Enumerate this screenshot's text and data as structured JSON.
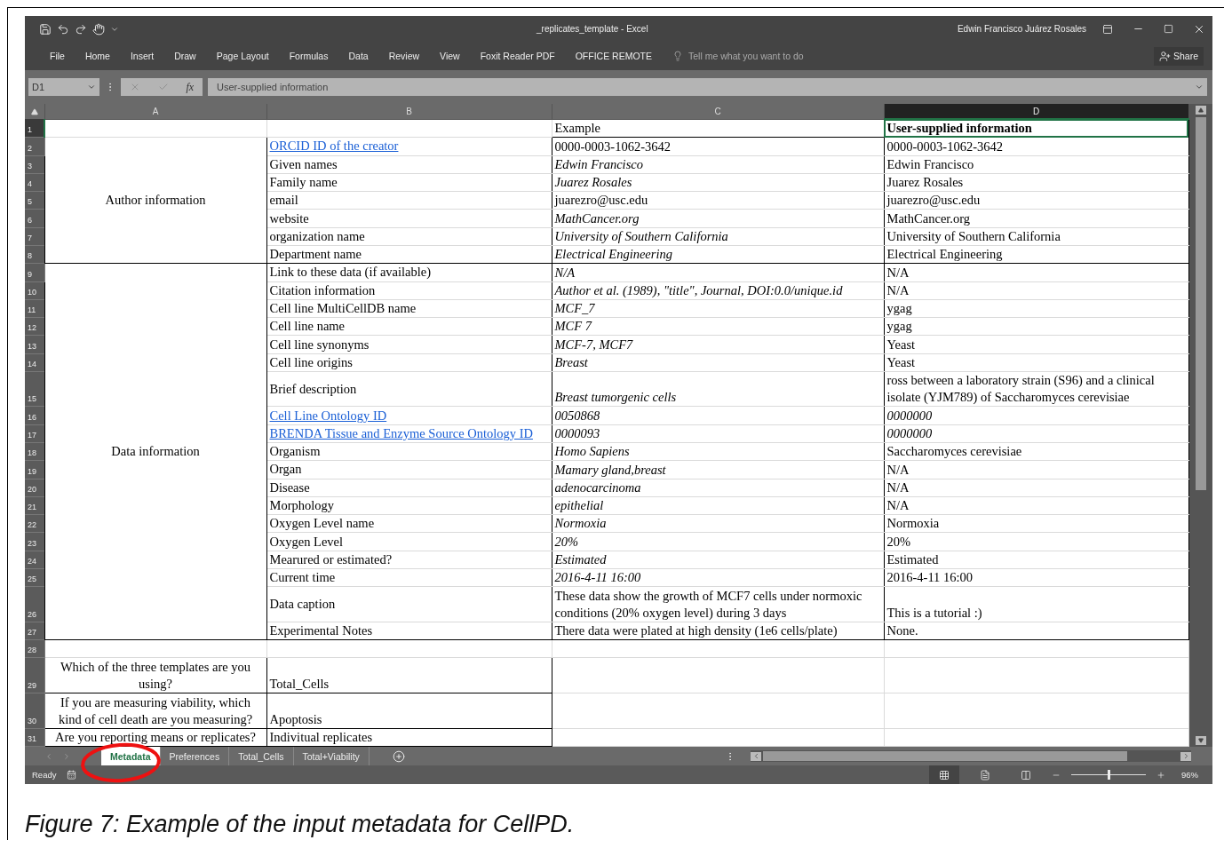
{
  "window": {
    "title": "_replicates_template - Excel",
    "user": "Edwin Francisco Juárez Rosales"
  },
  "ribbon": {
    "tabs": [
      "File",
      "Home",
      "Insert",
      "Draw",
      "Page Layout",
      "Formulas",
      "Data",
      "Review",
      "View",
      "Foxit Reader PDF",
      "OFFICE REMOTE"
    ],
    "tell_me": {
      "placeholder": "Tell me what you want to do"
    },
    "share": "Share"
  },
  "formula_bar": {
    "name_box": "D1",
    "function_label": "fx",
    "value": "User-supplied information"
  },
  "sheet": {
    "columns": [
      {
        "label": "A",
        "selected": false
      },
      {
        "label": "B",
        "selected": false
      },
      {
        "label": "C",
        "selected": false
      },
      {
        "label": "D",
        "selected": true
      }
    ],
    "blocks": [
      {
        "kind": "header",
        "rows": [
          {
            "number": "1",
            "selected": true,
            "c": {
              "text": "Example",
              "kind": "plain"
            },
            "d": {
              "text": "User-supplied information",
              "kind": "bold"
            }
          }
        ]
      },
      {
        "kind": "group",
        "label": "Author information",
        "rows": [
          {
            "number": "2",
            "selected": false,
            "b": {
              "text": "ORCID ID of the creator",
              "kind": "link"
            },
            "c": {
              "text": "0000-0003-1062-3642",
              "kind": "plain"
            },
            "d": {
              "text": "0000-0003-1062-3642",
              "kind": "plain"
            }
          },
          {
            "number": "3",
            "selected": false,
            "b": {
              "text": "Given names",
              "kind": "plain"
            },
            "c": {
              "text": "Edwin Francisco",
              "kind": "italic"
            },
            "d": {
              "text": "Edwin Francisco",
              "kind": "plain"
            }
          },
          {
            "number": "4",
            "selected": false,
            "b": {
              "text": "Family name",
              "kind": "plain"
            },
            "c": {
              "text": "Juarez Rosales",
              "kind": "italic"
            },
            "d": {
              "text": "Juarez Rosales",
              "kind": "plain"
            }
          },
          {
            "number": "5",
            "selected": false,
            "b": {
              "text": "email",
              "kind": "plain"
            },
            "c": {
              "text": "juarezro@usc.edu",
              "kind": "plain"
            },
            "d": {
              "text": "juarezro@usc.edu",
              "kind": "plain"
            }
          },
          {
            "number": "6",
            "selected": false,
            "b": {
              "text": "website",
              "kind": "plain"
            },
            "c": {
              "text": "MathCancer.org",
              "kind": "italic"
            },
            "d": {
              "text": "MathCancer.org",
              "kind": "plain"
            }
          },
          {
            "number": "7",
            "selected": false,
            "b": {
              "text": "organization name",
              "kind": "plain"
            },
            "c": {
              "text": "University of Southern California",
              "kind": "italic"
            },
            "d": {
              "text": "University of Southern California",
              "kind": "plain"
            }
          },
          {
            "number": "8",
            "selected": false,
            "b": {
              "text": "Department name",
              "kind": "plain"
            },
            "c": {
              "text": "Electrical Engineering",
              "kind": "italic"
            },
            "d": {
              "text": "Electrical Engineering",
              "kind": "plain"
            }
          }
        ]
      },
      {
        "kind": "group",
        "label": "Data information",
        "rows": [
          {
            "number": "9",
            "selected": false,
            "b": {
              "text": "Link to these data (if available)",
              "kind": "plain"
            },
            "c": {
              "text": "N/A",
              "kind": "italic"
            },
            "d": {
              "text": "N/A",
              "kind": "plain"
            }
          },
          {
            "number": "10",
            "selected": false,
            "b": {
              "text": "Citation information",
              "kind": "plain"
            },
            "c": {
              "text": "Author et al. (1989), \"title\", Journal, DOI:0.0/unique.id",
              "kind": "italic"
            },
            "d": {
              "text": "N/A",
              "kind": "plain"
            }
          },
          {
            "number": "11",
            "selected": false,
            "b": {
              "text": "Cell line MultiCellDB name",
              "kind": "plain"
            },
            "c": {
              "text": "MCF_7",
              "kind": "italic"
            },
            "d": {
              "text": "ygag",
              "kind": "plain"
            }
          },
          {
            "number": "12",
            "selected": false,
            "b": {
              "text": "Cell line name",
              "kind": "plain"
            },
            "c": {
              "text": "MCF 7",
              "kind": "italic"
            },
            "d": {
              "text": "ygag",
              "kind": "plain"
            }
          },
          {
            "number": "13",
            "selected": false,
            "b": {
              "text": "Cell line synonyms",
              "kind": "plain"
            },
            "c": {
              "text": "MCF-7, MCF7",
              "kind": "italic"
            },
            "d": {
              "text": "Yeast",
              "kind": "plain"
            }
          },
          {
            "number": "14",
            "selected": false,
            "b": {
              "text": "Cell line origins",
              "kind": "plain"
            },
            "c": {
              "text": "Breast",
              "kind": "italic"
            },
            "d": {
              "text": "Yeast",
              "kind": "plain"
            }
          },
          {
            "number": "15",
            "selected": false,
            "b": {
              "text": "Brief description",
              "kind": "plain"
            },
            "c": {
              "text": "Breast tumorgenic cells",
              "kind": "italic"
            },
            "d": {
              "text": "ross between a laboratory strain (S96) and a clinical isolate (YJM789) of Saccharomyces cerevisiae",
              "kind": "plain"
            }
          },
          {
            "number": "16",
            "selected": false,
            "b": {
              "text": "Cell Line Ontology ID",
              "kind": "link"
            },
            "c": {
              "text": "0050868",
              "kind": "italic"
            },
            "d": {
              "text": "0000000",
              "kind": "italic"
            }
          },
          {
            "number": "17",
            "selected": false,
            "b": {
              "text": "BRENDA Tissue and Enzyme Source Ontology ID",
              "kind": "link"
            },
            "c": {
              "text": "0000093",
              "kind": "italic"
            },
            "d": {
              "text": "0000000",
              "kind": "italic"
            }
          },
          {
            "number": "18",
            "selected": false,
            "b": {
              "text": "Organism",
              "kind": "plain"
            },
            "c": {
              "text": "Homo Sapiens",
              "kind": "italic"
            },
            "d": {
              "text": "Saccharomyces cerevisiae",
              "kind": "plain"
            }
          },
          {
            "number": "19",
            "selected": false,
            "b": {
              "text": "Organ",
              "kind": "plain"
            },
            "c": {
              "text": "Mamary gland,breast",
              "kind": "italic"
            },
            "d": {
              "text": "N/A",
              "kind": "plain"
            }
          },
          {
            "number": "20",
            "selected": false,
            "b": {
              "text": "Disease",
              "kind": "plain"
            },
            "c": {
              "text": "adenocarcinoma",
              "kind": "italic"
            },
            "d": {
              "text": "N/A",
              "kind": "plain"
            }
          },
          {
            "number": "21",
            "selected": false,
            "b": {
              "text": "Morphology",
              "kind": "plain"
            },
            "c": {
              "text": "epithelial",
              "kind": "italic"
            },
            "d": {
              "text": "N/A",
              "kind": "plain"
            }
          },
          {
            "number": "22",
            "selected": false,
            "b": {
              "text": "Oxygen Level name",
              "kind": "plain"
            },
            "c": {
              "text": "Normoxia",
              "kind": "italic"
            },
            "d": {
              "text": "Normoxia",
              "kind": "plain"
            }
          },
          {
            "number": "23",
            "selected": false,
            "b": {
              "text": "Oxygen Level",
              "kind": "plain"
            },
            "c": {
              "text": "20%",
              "kind": "italic"
            },
            "d": {
              "text": "20%",
              "kind": "plain"
            }
          },
          {
            "number": "24",
            "selected": false,
            "b": {
              "text": "Mearured or estimated?",
              "kind": "plain"
            },
            "c": {
              "text": "Estimated",
              "kind": "italic"
            },
            "d": {
              "text": "Estimated",
              "kind": "plain"
            }
          },
          {
            "number": "25",
            "selected": false,
            "b": {
              "text": "Current time",
              "kind": "plain"
            },
            "c": {
              "text": "2016-4-11 16:00",
              "kind": "italic"
            },
            "d": {
              "text": "2016-4-11 16:00",
              "kind": "plain"
            }
          },
          {
            "number": "26",
            "selected": false,
            "b": {
              "text": "Data caption",
              "kind": "plain"
            },
            "c": {
              "text": "These data show the growth of MCF7 cells under normoxic conditions (20% oxygen level) during 3 days",
              "kind": "plain"
            },
            "d": {
              "text": "This is a tutorial :)",
              "kind": "plain"
            }
          },
          {
            "number": "27",
            "selected": false,
            "b": {
              "text": "Experimental Notes",
              "kind": "plain"
            },
            "c": {
              "text": "There data were plated at high density (1e6 cells/plate)",
              "kind": "plain"
            },
            "d": {
              "text": "None.",
              "kind": "plain"
            }
          }
        ]
      },
      {
        "kind": "blank",
        "rows": [
          {
            "number": "28",
            "selected": false
          }
        ]
      },
      {
        "kind": "question",
        "rows": [
          {
            "number": "29",
            "selected": false,
            "a": {
              "text": "Which of the three templates are you using?",
              "kind": "plain"
            },
            "b": {
              "text": "Total_Cells",
              "kind": "plain"
            }
          },
          {
            "number": "30",
            "selected": false,
            "a": {
              "text": "If you are measuring viability, which kind of cell death are you measuring?",
              "kind": "plain"
            },
            "b": {
              "text": "Apoptosis",
              "kind": "plain"
            }
          },
          {
            "number": "31",
            "selected": false,
            "a": {
              "text": "Are you reporting means or replicates?",
              "kind": "plain"
            },
            "b": {
              "text": "Indivitual replicates",
              "kind": "plain"
            }
          }
        ]
      }
    ]
  },
  "sheet_tabs": [
    {
      "label": "Metadata",
      "selected": true
    },
    {
      "label": "Preferences",
      "selected": false
    },
    {
      "label": "Total_Cells",
      "selected": false
    },
    {
      "label": "Total+Viability",
      "selected": false
    }
  ],
  "status_bar": {
    "status": "Ready",
    "views": [
      {
        "kind": "normal",
        "selected": true
      },
      {
        "kind": "page_layout",
        "selected": false
      },
      {
        "kind": "page_break",
        "selected": false
      }
    ],
    "zoom": {
      "level": 0.5,
      "reading": "96%"
    }
  },
  "caption": "Figure 7: Example of the input metadata for CellPD."
}
